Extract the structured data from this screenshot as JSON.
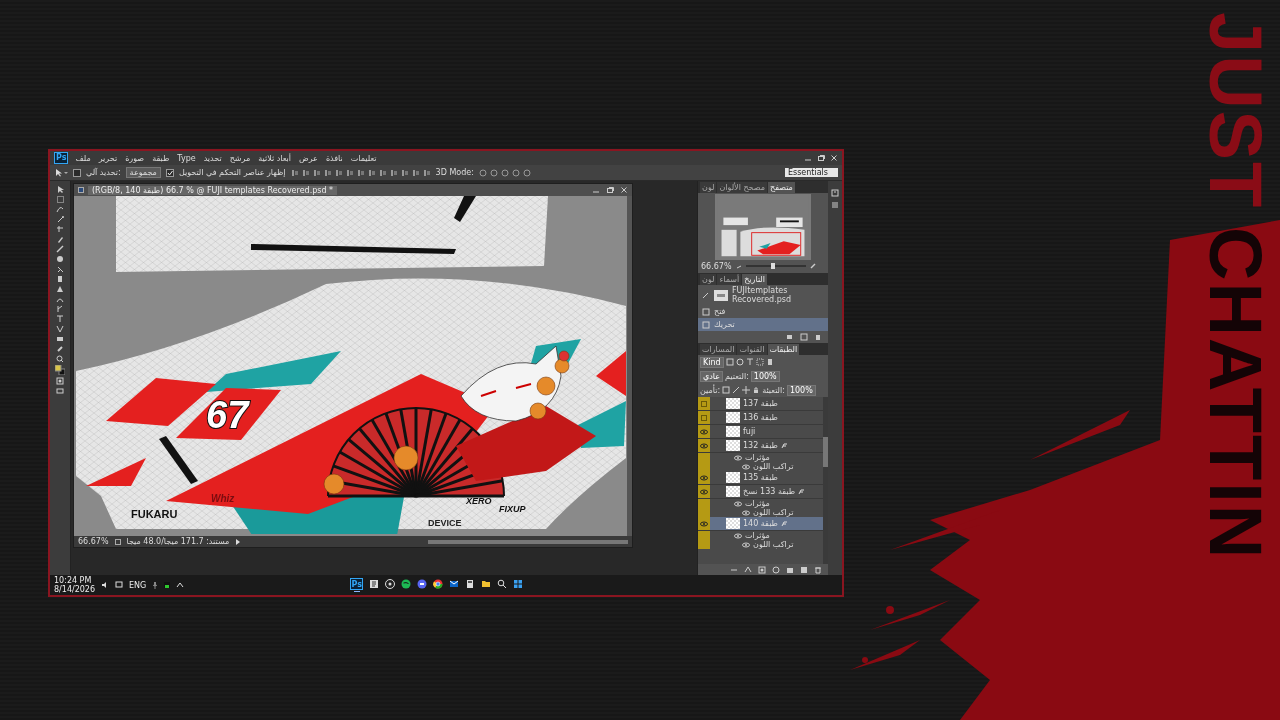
{
  "overlay": {
    "words": [
      "JUST",
      "CHATTIN"
    ]
  },
  "window": {
    "logo": "Ps",
    "menu": [
      "تعليمات",
      "نافذة",
      "عرض",
      "أبعاد ثلاثية",
      "مرشح",
      "تحديد",
      "Type",
      "طبقة",
      "صورة",
      "تحرير",
      "ملف"
    ]
  },
  "options_bar": {
    "auto_select": {
      "label": "تحديد آلي:",
      "checked": false
    },
    "auto_select_target": "مجموعة",
    "transform_controls": {
      "label": "إظهار عناصر التحكم في التحويل",
      "checked": true
    },
    "mode_label": "3D Mode:",
    "workspace": "Essentials"
  },
  "document": {
    "title": "(RGB/8, طبقة 140) 66.7 % @ FUJI templates Recovered.psd *",
    "artwork": {
      "number": "67",
      "logos": [
        "FUKARU",
        "Whiz",
        "XERO",
        "FIXUP",
        "DEVICE"
      ]
    },
    "zoom": "66.67%",
    "info": "مستند: 171.7 ميجا/48.0 ميجا"
  },
  "navigator": {
    "tabs": [
      {
        "label": "متصفح",
        "selected": true
      },
      {
        "label": "مصحح الألوان",
        "selected": false
      },
      {
        "label": "لون",
        "selected": false
      }
    ],
    "zoom": "66.67%",
    "level": 0.45
  },
  "history": {
    "tabs": [
      {
        "label": "التاريخ",
        "selected": true
      },
      {
        "label": "أسماء",
        "selected": false
      },
      {
        "label": "لون",
        "selected": false
      }
    ],
    "snapshot": "FUJItemplates Recovered.psd",
    "states": [
      {
        "label": "فتح",
        "selected": false
      },
      {
        "label": "تحريك",
        "selected": true
      }
    ]
  },
  "layers": {
    "tabs": [
      {
        "label": "الطبقات",
        "selected": true
      },
      {
        "label": "القنوات",
        "selected": false
      },
      {
        "label": "المسارات",
        "selected": false
      }
    ],
    "filter": "Kind",
    "blend_mode": "عادي",
    "opacity_label": "التعتيم:",
    "opacity": "100%",
    "lock_label": "تأمين:",
    "fill_label": "التعبئة:",
    "fill": "100%",
    "items": [
      {
        "name": "طبقة 137",
        "visible": false,
        "selected": false
      },
      {
        "name": "طبقة 136",
        "visible": false,
        "selected": false
      },
      {
        "name": "fuji",
        "visible": true,
        "selected": false
      },
      {
        "name": "طبقة 132",
        "visible": true,
        "selected": false,
        "effects": [
          "مؤثرات",
          "تراكب اللون"
        ]
      },
      {
        "name": "طبقة 135",
        "visible": true,
        "selected": false
      },
      {
        "name": "طبقة 133 نسخ",
        "visible": true,
        "selected": false,
        "effects": [
          "مؤثرات",
          "تراكب اللون"
        ]
      },
      {
        "name": "طبقة 140",
        "visible": true,
        "selected": true,
        "effects": [
          "مؤثرات",
          "تراكب اللون"
        ]
      }
    ]
  },
  "taskbar": {
    "time": "10:24 PM",
    "date": "8/14/2026",
    "language": "ENG",
    "apps": [
      {
        "kind": "photoshop",
        "label": "Ps",
        "active": true
      },
      {
        "kind": "notepad",
        "active": false
      },
      {
        "kind": "recorder",
        "active": false
      },
      {
        "kind": "music",
        "active": false
      },
      {
        "kind": "chat",
        "active": false
      },
      {
        "kind": "browser",
        "active": false
      },
      {
        "kind": "mail",
        "active": false
      },
      {
        "kind": "calculator",
        "active": false
      },
      {
        "kind": "folder",
        "active": false
      },
      {
        "kind": "search",
        "active": false
      },
      {
        "kind": "start",
        "active": false
      }
    ]
  }
}
